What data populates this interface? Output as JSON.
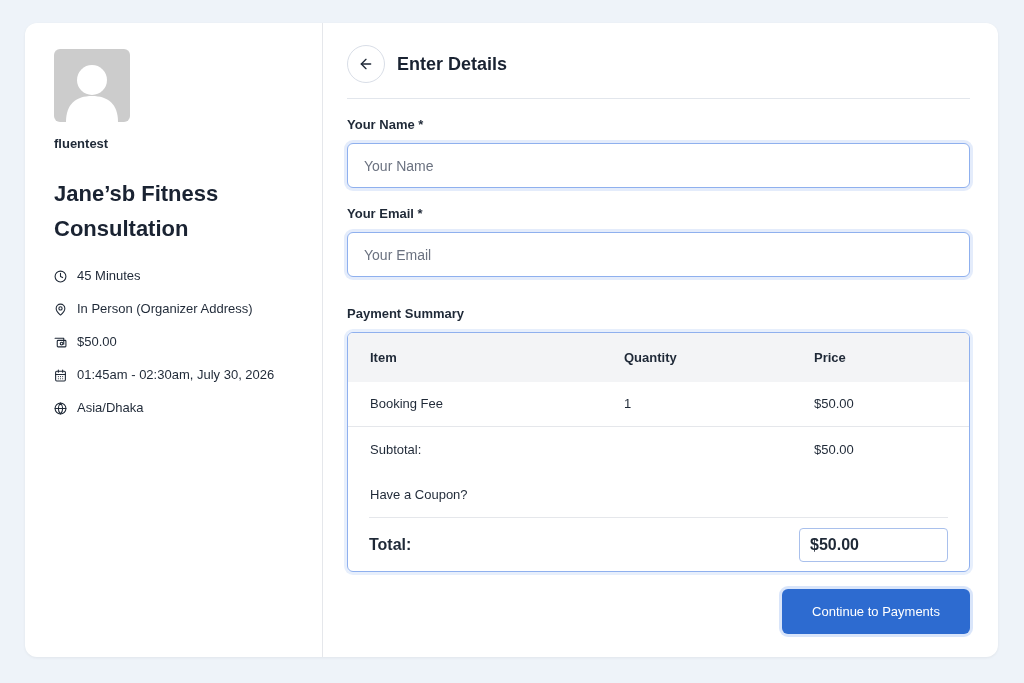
{
  "organizer": {
    "name": "fluentest"
  },
  "event": {
    "title": "Jane’sb Fitness Consultation",
    "details": [
      {
        "kind": "duration",
        "text": "45 Minutes"
      },
      {
        "kind": "location",
        "text": "In Person (Organizer Address)"
      },
      {
        "kind": "price",
        "text": "$50.00"
      },
      {
        "kind": "datetime",
        "text": "01:45am - 02:30am, July 30, 2026"
      },
      {
        "kind": "timezone",
        "text": "Asia/Dhaka"
      }
    ]
  },
  "form": {
    "title": "Enter Details",
    "fields": [
      {
        "label": "Your Name *",
        "placeholder": "Your Name"
      },
      {
        "label": "Your Email *",
        "placeholder": "Your Email"
      }
    ]
  },
  "payment_summary": {
    "title": "Payment Summary",
    "columns": [
      "Item",
      "Quantity",
      "Price"
    ],
    "rows": [
      [
        "Booking Fee",
        "1",
        "$50.00"
      ]
    ],
    "subtotal": {
      "label": "Subtotal:",
      "value": "$50.00"
    },
    "coupon_link": "Have a Coupon?",
    "total": {
      "label": "Total:",
      "value": "$50.00"
    }
  },
  "continue_button": "Continue to Payments"
}
